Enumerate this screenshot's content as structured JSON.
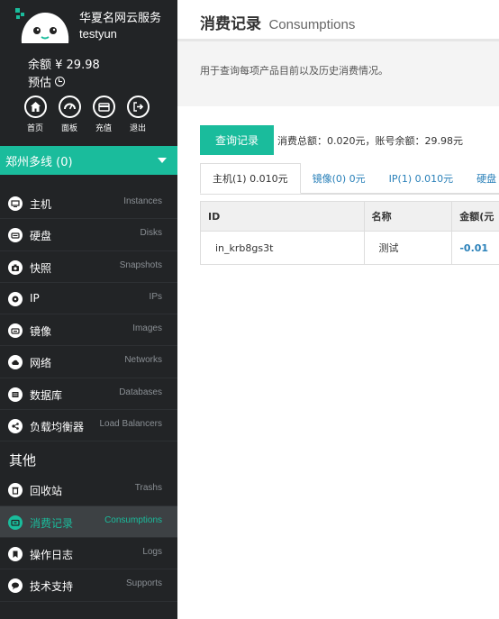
{
  "sidebar": {
    "brand": "华夏名网云服务",
    "username": "testyun",
    "balance": "余额 ¥ 29.98",
    "estimate": "预估",
    "quick_actions": [
      {
        "label": "首页",
        "icon": "home-icon"
      },
      {
        "label": "面板",
        "icon": "dashboard-icon"
      },
      {
        "label": "充值",
        "icon": "card-icon"
      },
      {
        "label": "退出",
        "icon": "logout-icon"
      }
    ],
    "region": "郑州多线 (0)",
    "items": [
      {
        "cn": "主机",
        "en": "Instances",
        "icon": "instance-icon"
      },
      {
        "cn": "硬盘",
        "en": "Disks",
        "icon": "disk-icon"
      },
      {
        "cn": "快照",
        "en": "Snapshots",
        "icon": "camera-icon"
      },
      {
        "cn": "IP",
        "en": "IPs",
        "icon": "ip-icon"
      },
      {
        "cn": "镜像",
        "en": "Images",
        "icon": "image-icon"
      },
      {
        "cn": "网络",
        "en": "Networks",
        "icon": "cloud-icon"
      },
      {
        "cn": "数据库",
        "en": "Databases",
        "icon": "database-icon"
      },
      {
        "cn": "负载均衡器",
        "en": "Load Balancers",
        "icon": "balancer-icon"
      }
    ],
    "other_title": "其他",
    "other_items": [
      {
        "cn": "回收站",
        "en": "Trashs",
        "icon": "trash-icon"
      },
      {
        "cn": "消费记录",
        "en": "Consumptions",
        "icon": "consumption-icon",
        "active": true
      },
      {
        "cn": "操作日志",
        "en": "Logs",
        "icon": "bookmark-icon"
      },
      {
        "cn": "技术支持",
        "en": "Supports",
        "icon": "chat-icon"
      }
    ]
  },
  "header": {
    "title_cn": "消费记录",
    "title_en": "Consumptions"
  },
  "description": "用于查询每项产品目前以及历史消费情况。",
  "toolbar": {
    "query_label": "查询记录",
    "summary": "消费总额：0.020元，账号余额：29.98元"
  },
  "tabs": [
    {
      "label": "主机(1) 0.010元",
      "active": true
    },
    {
      "label": "镜像(0) 0元"
    },
    {
      "label": "IP(1) 0.010元"
    },
    {
      "label": "硬盘"
    }
  ],
  "table": {
    "columns": [
      "ID",
      "名称",
      "金额(元"
    ],
    "rows": [
      [
        "in_krb8gs3t",
        "测试",
        "-0.01"
      ]
    ]
  },
  "colors": {
    "accent": "#1abc9c",
    "sidebar_bg": "#222426",
    "link": "#2980b9"
  }
}
